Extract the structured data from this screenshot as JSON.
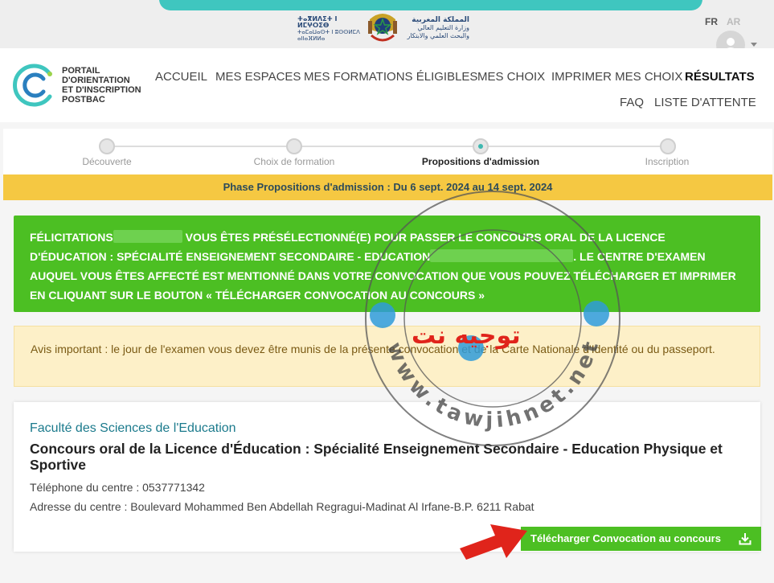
{
  "ministry": {
    "tifinagh_name": "ⵜⴰⴳⵍⴷⵉⵜ ⵏ ⵍⵎⵖⵔⵉⴱ",
    "tifinagh_sub": "ⵜⴰⵎⴰⵡⴰⵙⵜ ⵏ ⵓⵙⵙⵍⵎⴷ ⴰⵏⵏⴰⴼⵍⵍⴰ",
    "arabic_name": "المملكة المغربية",
    "arabic_sub": "وزارة التعليم العالي والبحث العلمي والابتكار"
  },
  "lang": {
    "fr": "FR",
    "ar": "AR"
  },
  "logo": {
    "line1": "PORTAIL",
    "line2": "D'ORIENTATION",
    "line3": "ET D'INSCRIPTION",
    "line4": "POSTBAC"
  },
  "nav": {
    "accueil": "ACCUEIL",
    "espaces": "MES ESPACES",
    "formations": "MES FORMATIONS ÉLIGIBLES",
    "choix": "MES CHOIX",
    "imprimer": "IMPRIMER MES CHOIX",
    "resultats": "RÉSULTATS",
    "faq": "FAQ",
    "attente": "LISTE D'ATTENTE"
  },
  "steps": [
    {
      "label": "Découverte"
    },
    {
      "label": "Choix de formation"
    },
    {
      "label": "Propositions d'admission"
    },
    {
      "label": "Inscription"
    }
  ],
  "phase": "Phase Propositions d'admission : Du 6 sept. 2024 au 14 sept. 2024",
  "congrats": {
    "part1": "FÉLICITATIONS",
    "part2": " VOUS ÊTES PRÉSÉLECTIONNÉ(E) POUR PASSER LE CONCOURS ORAL DE LA LICENCE D'ÉDUCATION : SPÉCIALITÉ ENSEIGNEMENT SECONDAIRE - EDUCATION",
    "part3": ". LE CENTRE D'EXAMEN AUQUEL VOUS ÊTES AFFECTÉ EST MENTIONNÉ DANS VOTRE CONVOCATION QUE VOUS POUVEZ TÉLÉCHARGER ET IMPRIMER EN CLIQUANT SUR LE BOUTON « TÉLÉCHARGER CONVOCATION AU CONCOURS »"
  },
  "notice": "Avis important : le jour de l'examen vous devez être munis de la présente convocation et de la Carte Nationale d'Identité ou du passeport.",
  "card": {
    "faculty": "Faculté des Sciences de l'Education",
    "title": "Concours oral de la Licence d'Éducation : Spécialité Enseignement Secondaire - Education Physique et Sportive",
    "phone": "Téléphone du centre : 0537771342",
    "address": "Adresse du centre : Boulevard Mohammed Ben Abdellah Regragui-Madinat Al Irfane-B.P. 6211 Rabat",
    "button": "Télécharger Convocation au concours"
  },
  "watermark": {
    "arabic": "توجيه نت",
    "url": "www.tawjihnet.net"
  },
  "colors": {
    "teal": "#3fc6bf",
    "green": "#4cbf23",
    "yellow": "#f5c842",
    "red": "#e0241b"
  }
}
